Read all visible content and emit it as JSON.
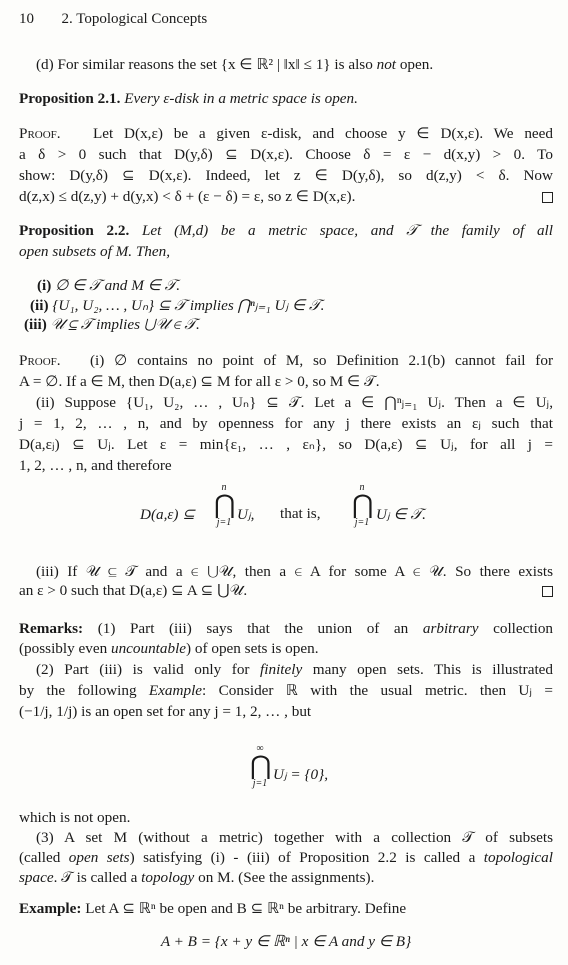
{
  "header": {
    "page_number": "10",
    "running_title": "2. Topological Concepts"
  },
  "item_d": {
    "text_before": "(d) For similar reasons the set {x ∈ ℝ² | ‖x‖ ≤ 1} is also ",
    "emph": "not",
    "text_after": " open."
  },
  "prop21": {
    "label": "Proposition 2.1.",
    "statement": "Every ε-disk in a metric space is open."
  },
  "proof1": {
    "label": "Proof.",
    "lines": [
      "Let D(x,ε) be a given ε-disk, and choose y ∈ D(x,ε). We need",
      "a δ > 0 such that D(y,δ) ⊆ D(x,ε). Choose δ = ε − d(x,y) > 0. To",
      "show: D(y,δ) ⊆ D(x,ε). Indeed, let z ∈ D(y,δ), so d(z,y) < δ. Now",
      "d(z,x) ≤ d(z,y) + d(y,x) < δ + (ε − δ) = ε, so z ∈ D(x,ε)."
    ]
  },
  "prop22": {
    "label": "Proposition 2.2.",
    "statement_lines": [
      "Let (M,d) be a metric space, and 𝒯 the family of all",
      "open subsets of M. Then,"
    ],
    "items": [
      {
        "num": "(i)",
        "text": "∅ ∈ 𝒯 and M ∈ 𝒯."
      },
      {
        "num": "(ii)",
        "text": "{U₁, U₂, … , Uₙ} ⊆ 𝒯 implies ⋂ⁿⱼ₌₁ Uⱼ ∈ 𝒯."
      },
      {
        "num": "(iii)",
        "text": "𝒰 ⊆ 𝒯 implies ⋃𝒰 ∈ 𝒯."
      }
    ]
  },
  "proof2": {
    "label": "Proof.",
    "lines": [
      "(i) ∅ contains no point of M, so Definition 2.1(b) cannot fail for",
      "A = ∅. If a ∈ M, then D(a,ε) ⊆ M for all ε > 0, so M ∈ 𝒯.",
      "(ii) Suppose {U₁, U₂, … , Uₙ} ⊆ 𝒯. Let a ∈ ⋂ⁿⱼ₌₁ Uⱼ. Then a ∈ Uⱼ,",
      "j = 1, 2, … , n, and by openness for any j there exists an εⱼ such that",
      "D(a,εⱼ) ⊆ Uⱼ. Let ε = min{ε₁, … , εₙ}, so D(a,ε) ⊆ Uⱼ, for all j =",
      "1, 2, … , n, and therefore"
    ],
    "display": {
      "left": "D(a,ε) ⊆",
      "op_sup": "n",
      "op_sub": "j=1",
      "left_after": "Uⱼ,",
      "middle": "that is,",
      "right_after": "Uⱼ ∈ 𝒯."
    },
    "lines_after": [
      "(iii) If 𝒰 ⊆ 𝒯 and a ∈ ⋃𝒰, then a ∈ A for some A ∈ 𝒰. So there exists",
      "an ε > 0 such that D(a,ε) ⊆ A ⊆ ⋃𝒰."
    ]
  },
  "remarks": {
    "label": "Remarks:",
    "r1_lines": [
      [
        "(1) Part (iii) says that the union of an ",
        "arbitrary",
        " collection"
      ],
      [
        "(possibly even ",
        "uncountable",
        ") of open sets is open."
      ]
    ],
    "r2_lines": [
      [
        "(2) Part (iii) is valid only for ",
        "finitely",
        " many open sets. This is illustrated"
      ],
      [
        "by the following ",
        "Example",
        ": Consider ℝ with the usual metric. then Uⱼ ="
      ],
      [
        "(−1/j, 1/j) is an open set for any j = 1, 2, … , but",
        "",
        ""
      ]
    ],
    "display2": {
      "op_sup": "∞",
      "op_sub": "j=1",
      "after": "Uⱼ = {0},"
    },
    "after_display": "which is not open.",
    "r3_lines": [
      [
        "(3) A set M (without a metric) together with a collection 𝒯 of subsets",
        "",
        ""
      ],
      [
        "(called ",
        "open sets",
        ") satisfying (i) - (iii) of Proposition 2.2 is called a "
      ],
      [
        "",
        "space",
        ". 𝒯 is called a "
      ]
    ],
    "r3_topological": "topological",
    "r3_topology": "topology",
    "r3_end": " on M. (See the assignments)."
  },
  "example": {
    "label": "Example:",
    "text": "Let A ⊆ ℝⁿ be open and B ⊆ ℝⁿ be arbitrary. Define",
    "display": "A + B = {x + y ∈ ℝⁿ | x ∈ A and y ∈ B}"
  }
}
